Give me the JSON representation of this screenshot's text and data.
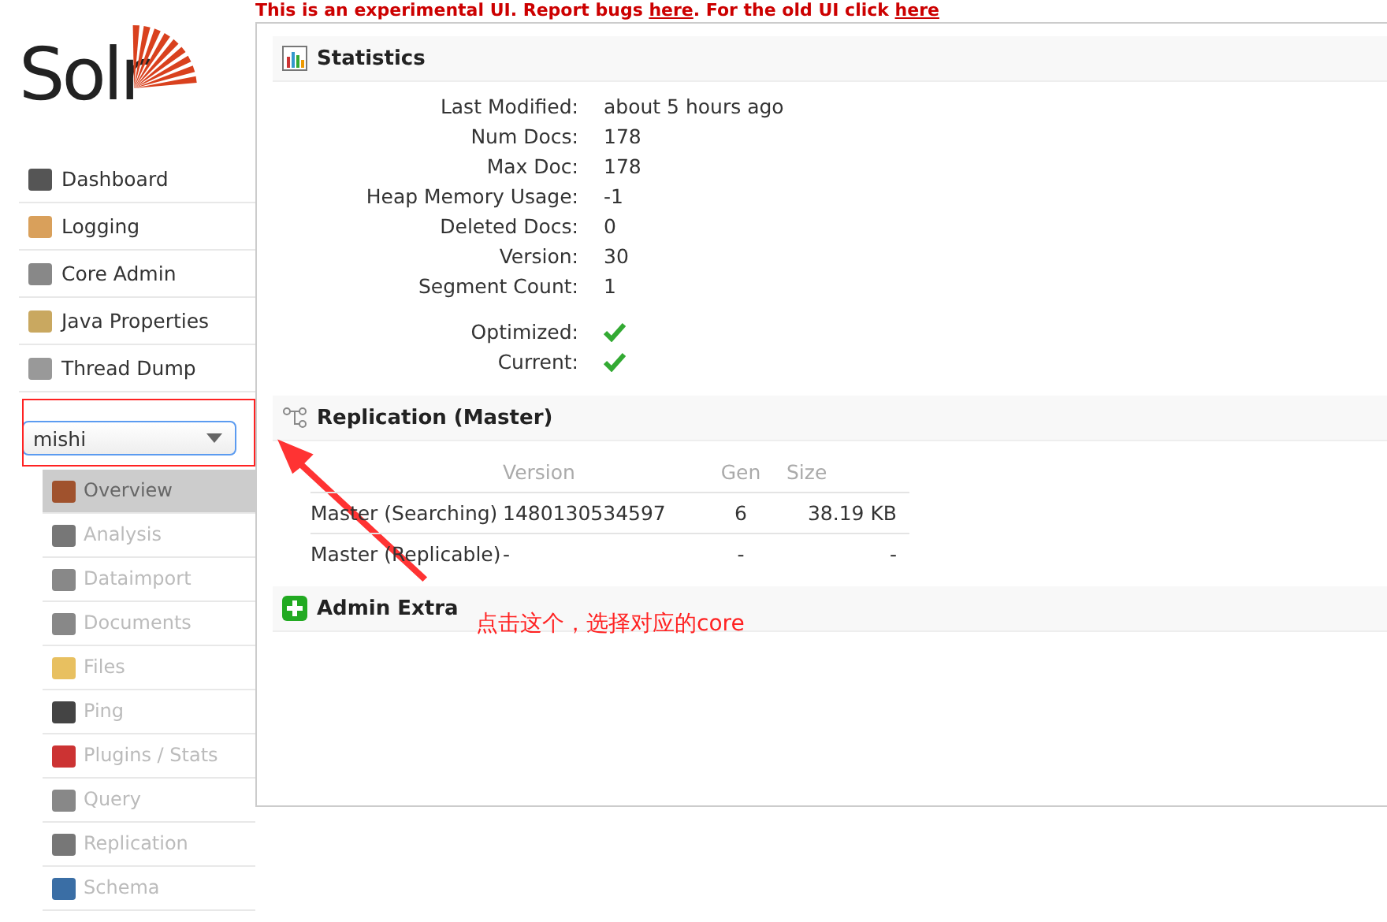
{
  "banner": {
    "text": "This is an experimental UI. Report bugs ",
    "link1": "here",
    "middle": ". For the old UI click ",
    "link2": "here"
  },
  "logo": {
    "text": "Solr"
  },
  "nav": [
    {
      "label": "Dashboard"
    },
    {
      "label": "Logging"
    },
    {
      "label": "Core Admin"
    },
    {
      "label": "Java Properties"
    },
    {
      "label": "Thread Dump"
    }
  ],
  "core_select": {
    "value": "mishi"
  },
  "core_menu": [
    {
      "label": "Overview",
      "selected": true
    },
    {
      "label": "Analysis",
      "selected": false
    },
    {
      "label": "Dataimport",
      "selected": false
    },
    {
      "label": "Documents",
      "selected": false
    },
    {
      "label": "Files",
      "selected": false
    },
    {
      "label": "Ping",
      "selected": false
    },
    {
      "label": "Plugins / Stats",
      "selected": false
    },
    {
      "label": "Query",
      "selected": false
    },
    {
      "label": "Replication",
      "selected": false
    },
    {
      "label": "Schema",
      "selected": false
    }
  ],
  "statistics": {
    "title": "Statistics",
    "rows": [
      {
        "kind": "text",
        "label": "Last Modified:",
        "value": "about 5 hours ago"
      },
      {
        "kind": "text",
        "label": "Num Docs:",
        "value": "178"
      },
      {
        "kind": "text",
        "label": "Max Doc:",
        "value": "178"
      },
      {
        "kind": "text",
        "label": "Heap Memory Usage:",
        "value": "-1"
      },
      {
        "kind": "text",
        "label": "Deleted Docs:",
        "value": "0"
      },
      {
        "kind": "text",
        "label": "Version:",
        "value": "30"
      },
      {
        "kind": "text",
        "label": "Segment Count:",
        "value": "1"
      },
      {
        "kind": "check",
        "label": "Optimized:",
        "checked": true
      },
      {
        "kind": "check",
        "label": "Current:",
        "checked": true
      }
    ]
  },
  "replication": {
    "title": "Replication (Master)",
    "columns": [
      "Version",
      "Gen",
      "Size"
    ],
    "rows": [
      {
        "label": "Master (Searching)",
        "cells": [
          "1480130534597",
          "6",
          "38.19 KB"
        ]
      },
      {
        "label": "Master (Replicable)",
        "cells": [
          "-",
          "-",
          "-"
        ]
      }
    ]
  },
  "admin_extra": {
    "title": "Admin Extra"
  },
  "annotation": {
    "text": "点击这个，选择对应的core"
  }
}
